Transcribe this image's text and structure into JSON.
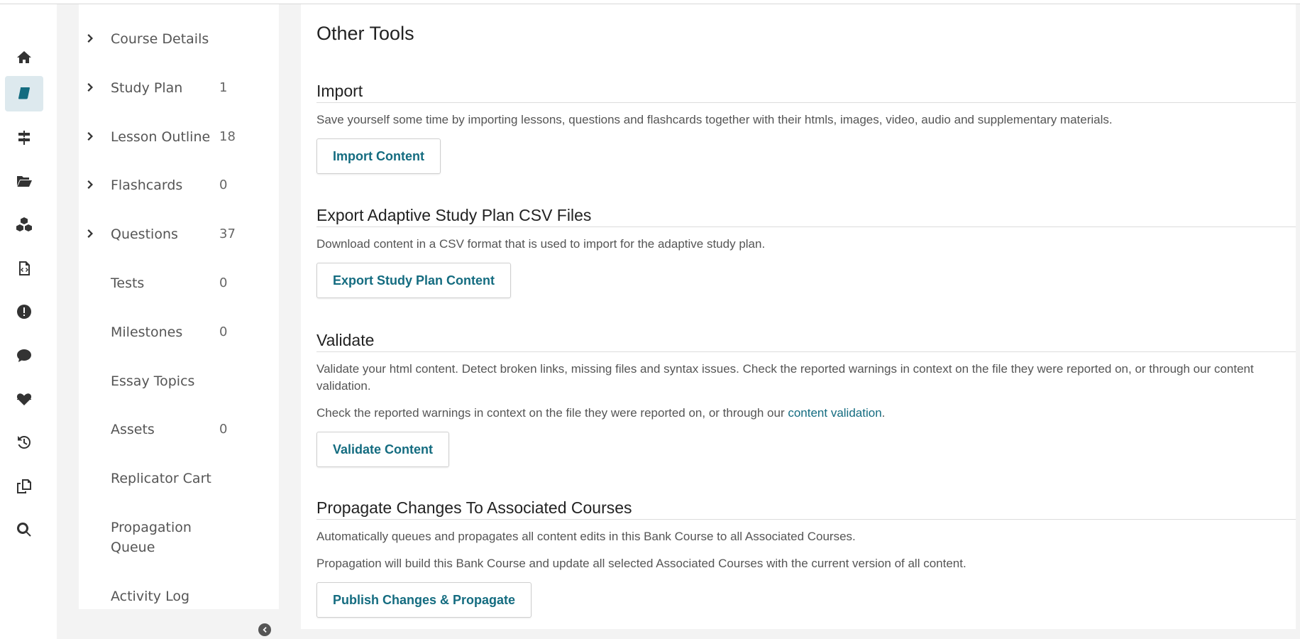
{
  "nav": {
    "items": [
      {
        "label": "Course Details",
        "count": "",
        "expandable": true
      },
      {
        "label": "Study Plan",
        "count": "1",
        "expandable": true
      },
      {
        "label": "Lesson Outline",
        "count": "18",
        "expandable": true
      },
      {
        "label": "Flashcards",
        "count": "0",
        "expandable": true
      },
      {
        "label": "Questions",
        "count": "37",
        "expandable": true
      },
      {
        "label": "Tests",
        "count": "0",
        "expandable": false
      },
      {
        "label": "Milestones",
        "count": "0",
        "expandable": false
      },
      {
        "label": "Essay Topics",
        "count": "",
        "expandable": false
      },
      {
        "label": "Assets",
        "count": "0",
        "expandable": false
      },
      {
        "label": "Replicator Cart",
        "count": "",
        "expandable": false
      },
      {
        "label": "Propagation Queue",
        "count": "",
        "expandable": false
      },
      {
        "label": "Activity Log",
        "count": "",
        "expandable": false
      }
    ]
  },
  "rail": {
    "icons": [
      "home-icon",
      "book-icon",
      "signpost-icon",
      "folder-open-icon",
      "cubes-icon",
      "code-file-icon",
      "alert-icon",
      "comment-icon",
      "heartbeat-icon",
      "history-icon",
      "copy-icon",
      "search-icon"
    ],
    "active": "book-icon"
  },
  "main": {
    "title": "Other Tools",
    "import": {
      "heading": "Import",
      "description": "Save yourself some time by importing lessons, questions and flashcards together with their htmls, images, video, audio and supplementary materials.",
      "button": "Import Content"
    },
    "export": {
      "heading": "Export Adaptive Study Plan CSV Files",
      "description": "Download content in a CSV format that is used to import for the adaptive study plan.",
      "button": "Export Study Plan Content"
    },
    "validate": {
      "heading": "Validate",
      "description": "Validate your html content. Detect broken links, missing files and syntax issues. Check the reported warnings in context on the file they were reported on, or through our content validation.",
      "description2_prefix": "Check the reported warnings in context on the file they were reported on, or through our ",
      "description2_link": "content validation",
      "description2_suffix": ".",
      "button": "Validate Content"
    },
    "propagate": {
      "heading": "Propagate Changes To Associated Courses",
      "description": "Automatically queues and propagates all content edits in this Bank Course to all Associated Courses.",
      "description2": "Propagation will build this Bank Course and update all selected Associated Courses with the current version of all content.",
      "button": "Publish Changes & Propagate"
    }
  },
  "colors": {
    "accent": "#146c80",
    "active_bg": "#dde9ee"
  }
}
